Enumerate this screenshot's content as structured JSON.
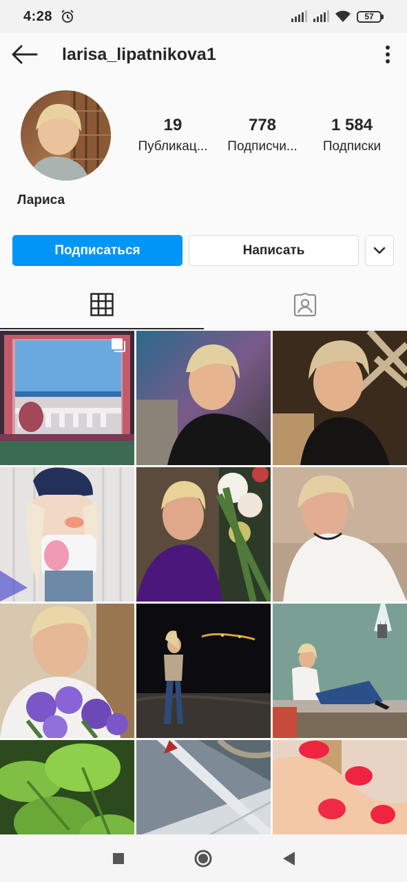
{
  "status_bar": {
    "time": "4:28",
    "battery": "57",
    "icons": [
      "alarm-icon",
      "signal-icon",
      "signal-icon",
      "wifi-icon",
      "battery-icon"
    ]
  },
  "header": {
    "username": "larisa_lipatnikova1",
    "back_icon": "arrow-left-icon",
    "more_icon": "more-vertical-icon"
  },
  "profile": {
    "name": "Лариса",
    "stats": [
      {
        "value": "19",
        "label": "Публикац..."
      },
      {
        "value": "778",
        "label": "Подписчи..."
      },
      {
        "value": "1 584",
        "label": "Подписки"
      }
    ]
  },
  "actions": {
    "follow": "Подписаться",
    "message": "Написать",
    "dropdown_icon": "chevron-down-icon"
  },
  "colors": {
    "accent": "#0095f6",
    "text": "#262626",
    "border": "#dbdbdb",
    "background": "#fafafa"
  },
  "tabs": [
    {
      "icon": "grid-icon",
      "active": true
    },
    {
      "icon": "tagged-icon",
      "active": false
    }
  ],
  "posts": [
    {
      "subject": "sea-balcony-photo",
      "multi": true
    },
    {
      "subject": "woman-selfie-black-lace"
    },
    {
      "subject": "woman-selfie-black-top"
    },
    {
      "subject": "doll-photo"
    },
    {
      "subject": "woman-purple-flowers"
    },
    {
      "subject": "woman-white-blouse"
    },
    {
      "subject": "woman-bellflowers"
    },
    {
      "subject": "woman-night-seaside"
    },
    {
      "subject": "woman-fountain"
    },
    {
      "subject": "green-leaves"
    },
    {
      "subject": "airplane-wing-view"
    },
    {
      "subject": "red-nails"
    }
  ],
  "nav": [
    "square-icon",
    "circle-icon",
    "back-triangle-icon"
  ]
}
